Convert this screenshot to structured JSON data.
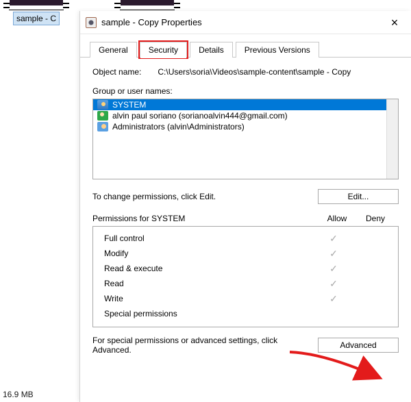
{
  "desktop": {
    "file_label": "sample - C",
    "info_line": "16.9 MB"
  },
  "window": {
    "title": "sample - Copy Properties",
    "tabs": {
      "general": "General",
      "security": "Security",
      "details": "Details",
      "previous": "Previous Versions"
    },
    "object_name_label": "Object name:",
    "object_name_value": "C:\\Users\\soria\\Videos\\sample-content\\sample - Copy",
    "group_label": "Group or user names:",
    "users": [
      {
        "name": "SYSTEM"
      },
      {
        "name": "alvin paul soriano (sorianoalvin444@gmail.com)"
      },
      {
        "name": "Administrators (alvin\\Administrators)"
      }
    ],
    "edit_hint": "To change permissions, click Edit.",
    "edit_button": "Edit...",
    "perm_header": "Permissions for SYSTEM",
    "allow_label": "Allow",
    "deny_label": "Deny",
    "permissions": {
      "full": "Full control",
      "modify": "Modify",
      "readexec": "Read & execute",
      "read": "Read",
      "write": "Write",
      "special": "Special permissions"
    },
    "check": "✓",
    "adv_hint": "For special permissions or advanced settings, click Advanced.",
    "adv_button": "Advanced"
  }
}
